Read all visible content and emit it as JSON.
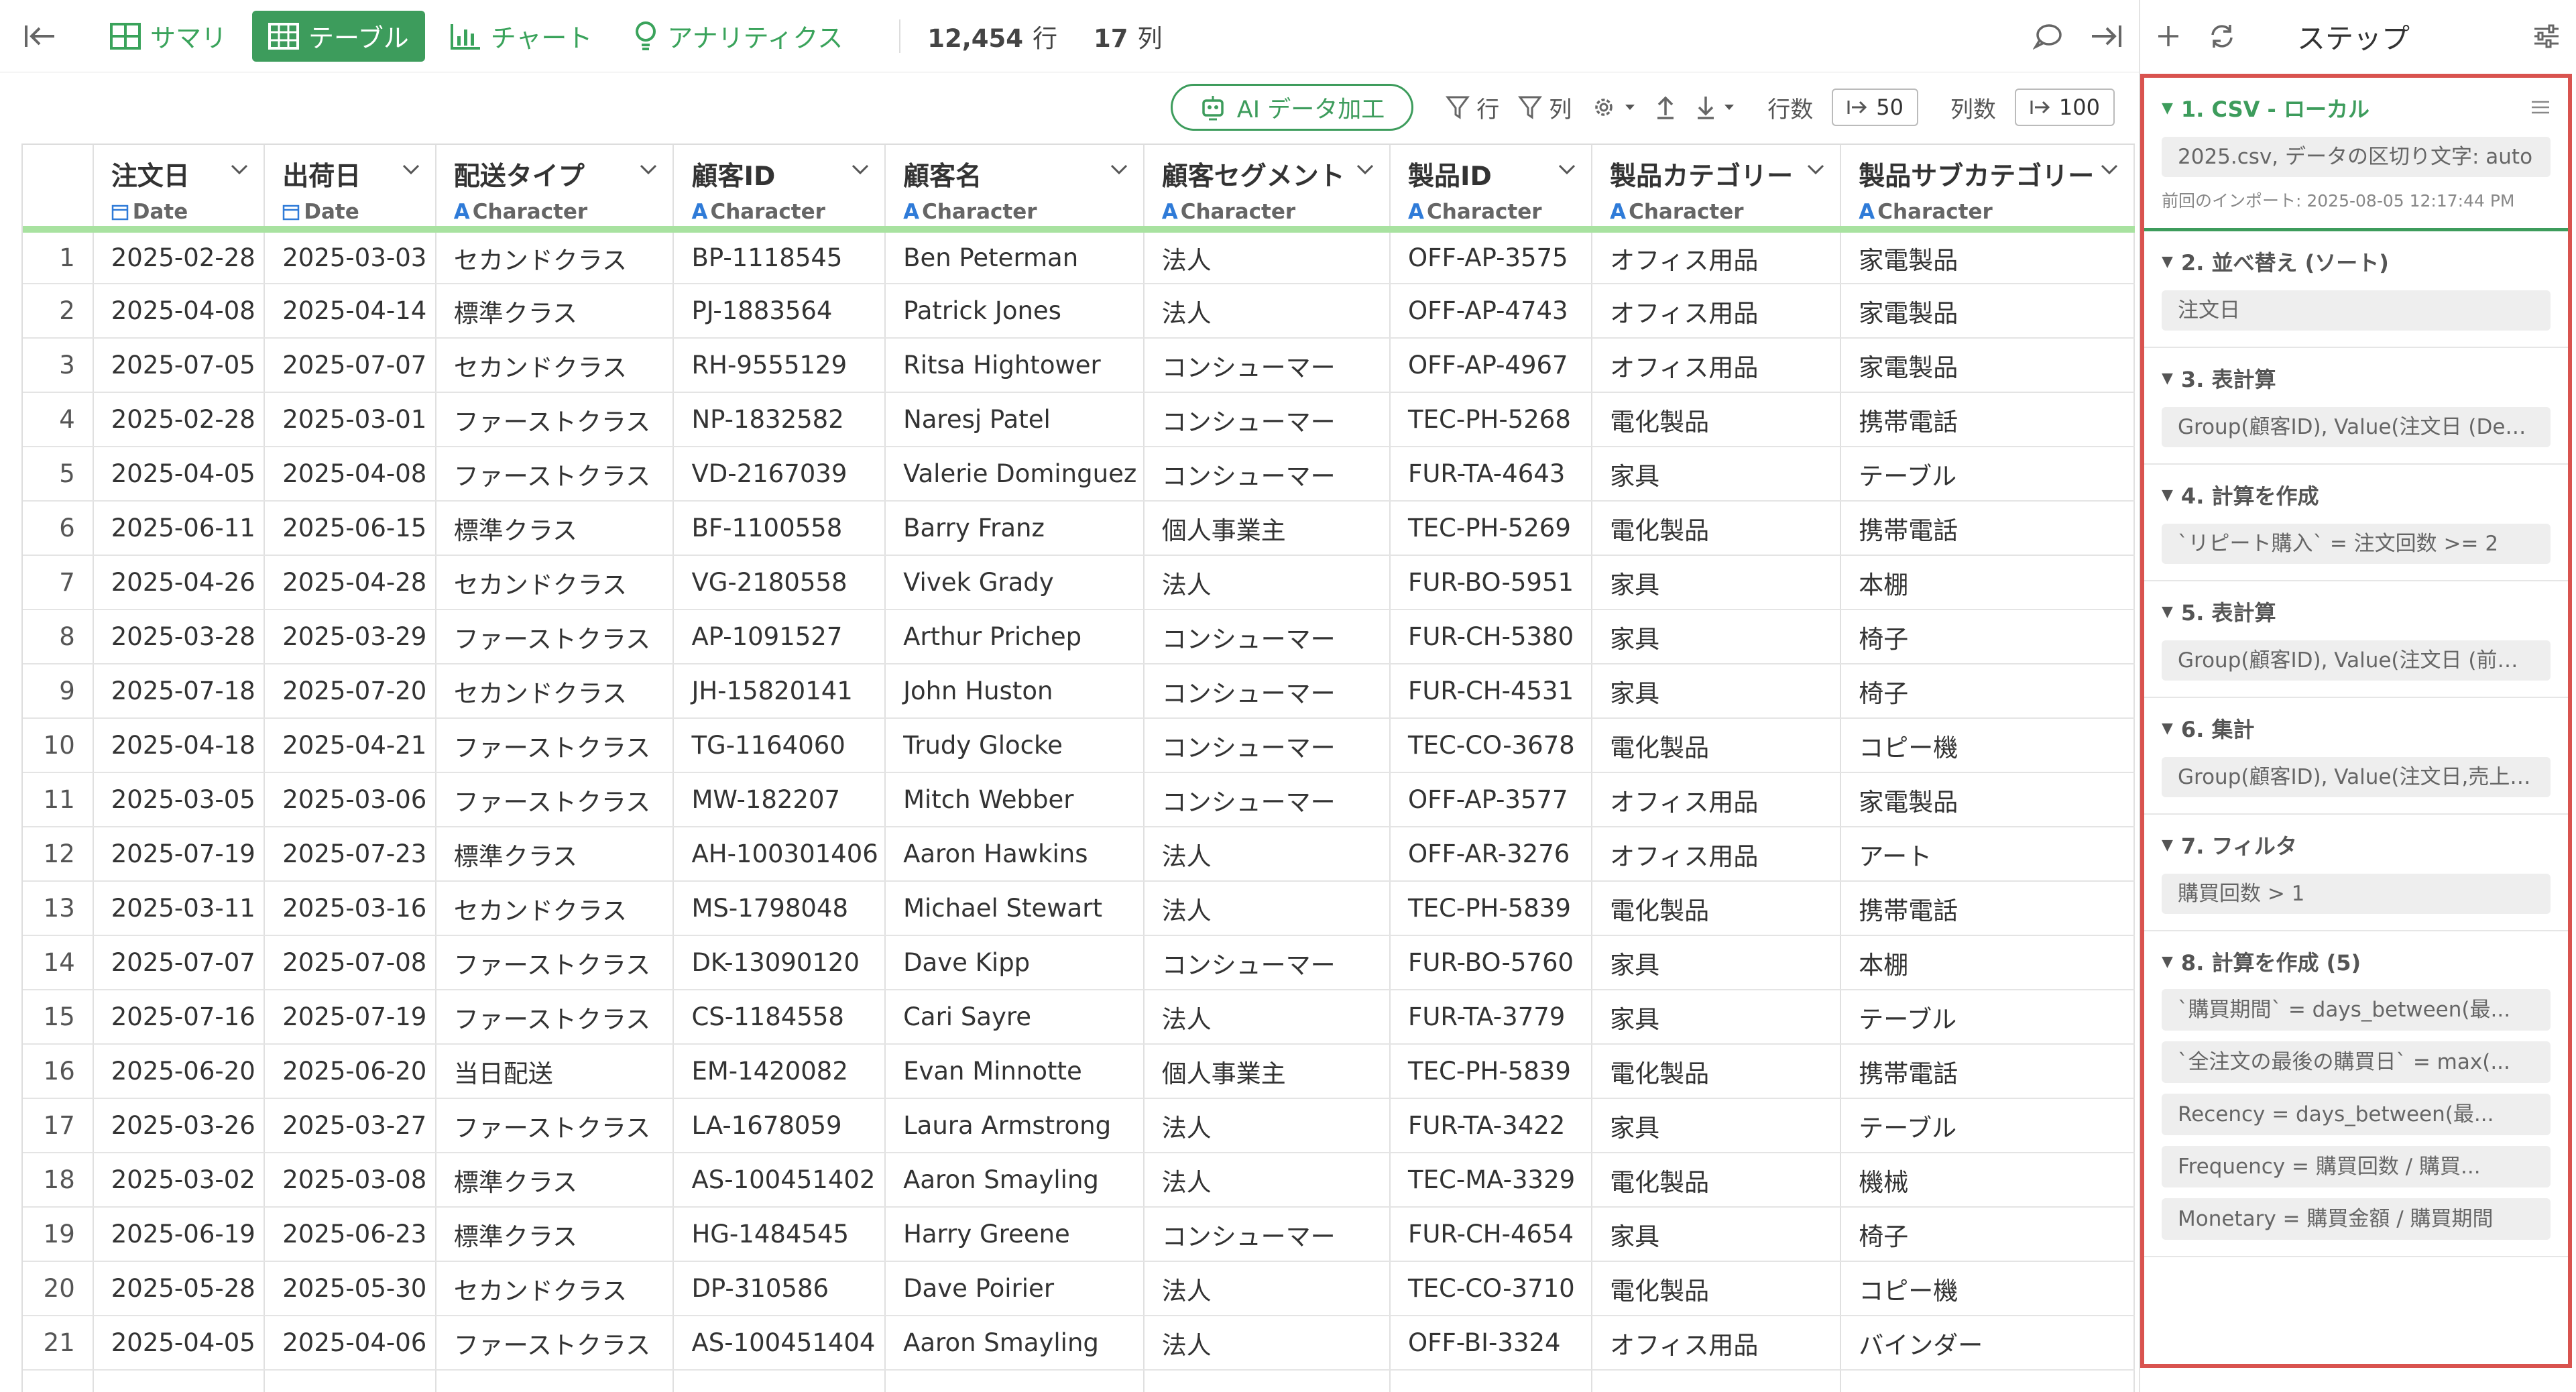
{
  "view_tabs": [
    {
      "label": "サマリ"
    },
    {
      "label": "テーブル"
    },
    {
      "label": "チャート"
    },
    {
      "label": "アナリティクス"
    }
  ],
  "rows_count": {
    "value": "12,454",
    "unit": "行"
  },
  "cols_count": {
    "value": "17",
    "unit": "列"
  },
  "toolbar": {
    "ai_label": "AI データ加工",
    "filter_row": "行",
    "filter_col": "列",
    "row_count_label": "行数",
    "row_count_value": "50",
    "col_count_label": "列数",
    "col_count_value": "100"
  },
  "columns": [
    {
      "name": "注文日",
      "type": "Date",
      "type_icon": "calendar-icon"
    },
    {
      "name": "出荷日",
      "type": "Date",
      "type_icon": "calendar-icon"
    },
    {
      "name": "配送タイプ",
      "type": "Character",
      "type_icon": "A"
    },
    {
      "name": "顧客ID",
      "type": "Character",
      "type_icon": "A"
    },
    {
      "name": "顧客名",
      "type": "Character",
      "type_icon": "A"
    },
    {
      "name": "顧客セグメント",
      "type": "Character",
      "type_icon": "A"
    },
    {
      "name": "製品ID",
      "type": "Character",
      "type_icon": "A"
    },
    {
      "name": "製品カテゴリー",
      "type": "Character",
      "type_icon": "A"
    },
    {
      "name": "製品サブカテゴリー",
      "type": "Character",
      "type_icon": "A"
    }
  ],
  "rows": [
    [
      "2025-02-28",
      "2025-03-03",
      "セカンドクラス",
      "BP-1118545",
      "Ben Peterman",
      "法人",
      "OFF-AP-3575",
      "オフィス用品",
      "家電製品"
    ],
    [
      "2025-04-08",
      "2025-04-14",
      "標準クラス",
      "PJ-1883564",
      "Patrick Jones",
      "法人",
      "OFF-AP-4743",
      "オフィス用品",
      "家電製品"
    ],
    [
      "2025-07-05",
      "2025-07-07",
      "セカンドクラス",
      "RH-9555129",
      "Ritsa Hightower",
      "コンシューマー",
      "OFF-AP-4967",
      "オフィス用品",
      "家電製品"
    ],
    [
      "2025-02-28",
      "2025-03-01",
      "ファーストクラス",
      "NP-1832582",
      "Naresj Patel",
      "コンシューマー",
      "TEC-PH-5268",
      "電化製品",
      "携帯電話"
    ],
    [
      "2025-04-05",
      "2025-04-08",
      "ファーストクラス",
      "VD-2167039",
      "Valerie Dominguez",
      "コンシューマー",
      "FUR-TA-4643",
      "家具",
      "テーブル"
    ],
    [
      "2025-06-11",
      "2025-06-15",
      "標準クラス",
      "BF-1100558",
      "Barry Franz",
      "個人事業主",
      "TEC-PH-5269",
      "電化製品",
      "携帯電話"
    ],
    [
      "2025-04-26",
      "2025-04-28",
      "セカンドクラス",
      "VG-2180558",
      "Vivek Grady",
      "法人",
      "FUR-BO-5951",
      "家具",
      "本棚"
    ],
    [
      "2025-03-28",
      "2025-03-29",
      "ファーストクラス",
      "AP-1091527",
      "Arthur Prichep",
      "コンシューマー",
      "FUR-CH-5380",
      "家具",
      "椅子"
    ],
    [
      "2025-07-18",
      "2025-07-20",
      "セカンドクラス",
      "JH-15820141",
      "John Huston",
      "コンシューマー",
      "FUR-CH-4531",
      "家具",
      "椅子"
    ],
    [
      "2025-04-18",
      "2025-04-21",
      "ファーストクラス",
      "TG-1164060",
      "Trudy Glocke",
      "コンシューマー",
      "TEC-CO-3678",
      "電化製品",
      "コピー機"
    ],
    [
      "2025-03-05",
      "2025-03-06",
      "ファーストクラス",
      "MW-182207",
      "Mitch Webber",
      "コンシューマー",
      "OFF-AP-3577",
      "オフィス用品",
      "家電製品"
    ],
    [
      "2025-07-19",
      "2025-07-23",
      "標準クラス",
      "AH-100301406",
      "Aaron Hawkins",
      "法人",
      "OFF-AR-3276",
      "オフィス用品",
      "アート"
    ],
    [
      "2025-03-11",
      "2025-03-16",
      "セカンドクラス",
      "MS-1798048",
      "Michael Stewart",
      "法人",
      "TEC-PH-5839",
      "電化製品",
      "携帯電話"
    ],
    [
      "2025-07-07",
      "2025-07-08",
      "ファーストクラス",
      "DK-13090120",
      "Dave Kipp",
      "コンシューマー",
      "FUR-BO-5760",
      "家具",
      "本棚"
    ],
    [
      "2025-07-16",
      "2025-07-19",
      "ファーストクラス",
      "CS-1184558",
      "Cari Sayre",
      "法人",
      "FUR-TA-3779",
      "家具",
      "テーブル"
    ],
    [
      "2025-06-20",
      "2025-06-20",
      "当日配送",
      "EM-1420082",
      "Evan Minnotte",
      "個人事業主",
      "TEC-PH-5839",
      "電化製品",
      "携帯電話"
    ],
    [
      "2025-03-26",
      "2025-03-27",
      "ファーストクラス",
      "LA-1678059",
      "Laura Armstrong",
      "法人",
      "FUR-TA-3422",
      "家具",
      "テーブル"
    ],
    [
      "2025-03-02",
      "2025-03-08",
      "標準クラス",
      "AS-100451402",
      "Aaron Smayling",
      "法人",
      "TEC-MA-3329",
      "電化製品",
      "機械"
    ],
    [
      "2025-06-19",
      "2025-06-23",
      "標準クラス",
      "HG-1484545",
      "Harry Greene",
      "コンシューマー",
      "FUR-CH-4654",
      "家具",
      "椅子"
    ],
    [
      "2025-05-28",
      "2025-05-30",
      "セカンドクラス",
      "DP-310586",
      "Dave Poirier",
      "法人",
      "TEC-CO-3710",
      "電化製品",
      "コピー機"
    ],
    [
      "2025-04-05",
      "2025-04-06",
      "ファーストクラス",
      "AS-100451404",
      "Aaron Smayling",
      "法人",
      "OFF-BI-3324",
      "オフィス用品",
      "バインダー"
    ],
    [
      "",
      "",
      "",
      "",
      "",
      "",
      "",
      "",
      ""
    ]
  ],
  "steps_panel": {
    "title": "ステップ",
    "steps": [
      {
        "title": "1. CSV - ローカル",
        "chips": [
          "2025.csv, データの区切り文字: auto"
        ],
        "sub": "前回のインポート: 2025-08-05 12:17:44 PM"
      },
      {
        "title": "2. 並べ替え (ソート)",
        "chips": [
          "注文日"
        ]
      },
      {
        "title": "3. 表計算",
        "chips": [
          "Group(顧客ID), Value(注文日 (Dense..."
        ]
      },
      {
        "title": "4. 計算を作成",
        "chips": [
          "`リピート購入` = 注文回数 >= 2"
        ]
      },
      {
        "title": "5. 表計算",
        "chips": [
          "Group(顧客ID), Value(注文日 (前の値..."
        ]
      },
      {
        "title": "6. 集計",
        "chips": [
          "Group(顧客ID), Value(注文日,売上 (..."
        ]
      },
      {
        "title": "7. フィルタ",
        "chips": [
          "購買回数 > 1"
        ]
      },
      {
        "title": "8. 計算を作成 (5)",
        "chips": [
          "`購買期間` = days_between(最...",
          "`全注文の最後の購買日` = max(...",
          "Recency = days_between(最...",
          "Frequency = 購買回数 / 購買...",
          "Monetary = 購買金額 / 購買期間"
        ]
      }
    ]
  }
}
